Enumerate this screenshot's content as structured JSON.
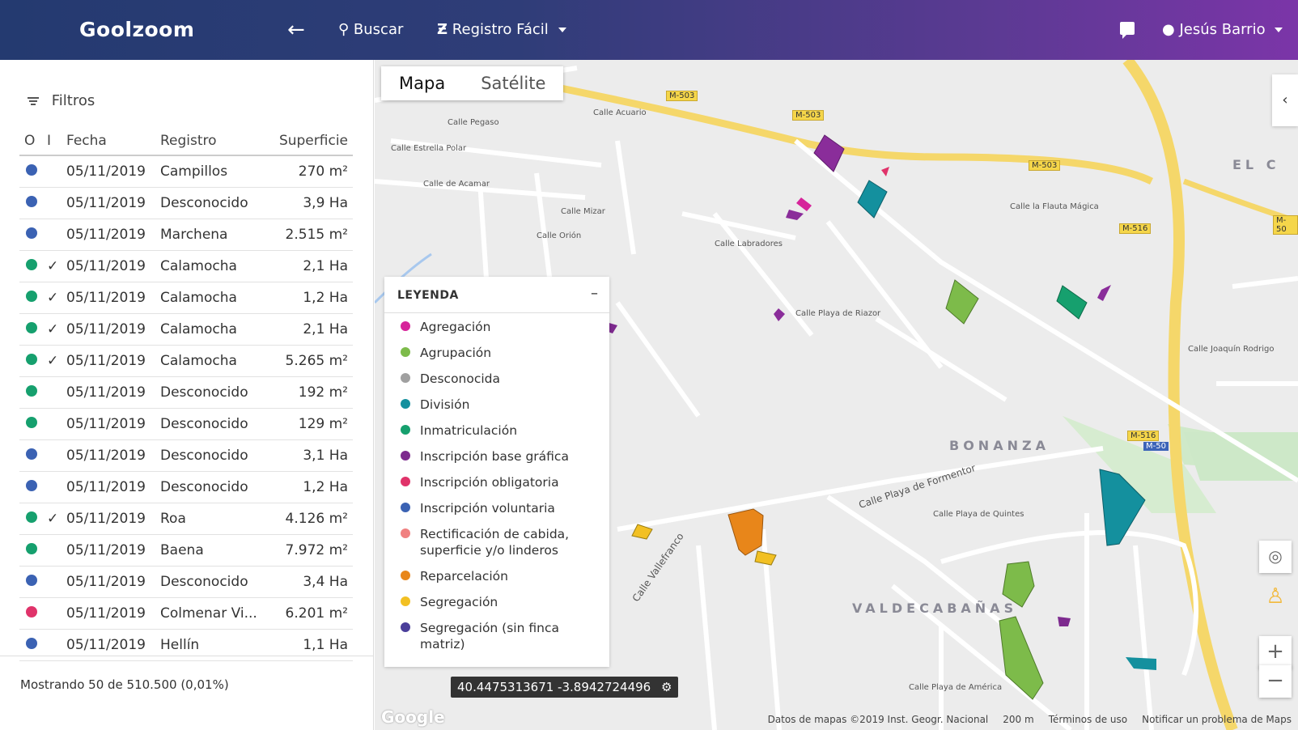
{
  "header": {
    "logo": "Goolzoom",
    "back_glyph": "←",
    "search_label": "Buscar",
    "registro_label": "Registro Fácil",
    "user_label": "Jesús Barrio"
  },
  "sidebar": {
    "filters_label": "Filtros",
    "columns": [
      "O",
      "I",
      "Fecha",
      "Registro",
      "Superficie"
    ],
    "rows": [
      {
        "color": "#3b62b3",
        "check": "",
        "fecha": "05/11/2019",
        "registro": "Campillos",
        "superficie": "270 m²"
      },
      {
        "color": "#3b62b3",
        "check": "",
        "fecha": "05/11/2019",
        "registro": "Desconocido",
        "superficie": "3,9 Ha"
      },
      {
        "color": "#3b62b3",
        "check": "",
        "fecha": "05/11/2019",
        "registro": "Marchena",
        "superficie": "2.515 m²"
      },
      {
        "color": "#16a06e",
        "check": "✓",
        "fecha": "05/11/2019",
        "registro": "Calamocha",
        "superficie": "2,1 Ha"
      },
      {
        "color": "#16a06e",
        "check": "✓",
        "fecha": "05/11/2019",
        "registro": "Calamocha",
        "superficie": "1,2 Ha"
      },
      {
        "color": "#16a06e",
        "check": "✓",
        "fecha": "05/11/2019",
        "registro": "Calamocha",
        "superficie": "2,1 Ha"
      },
      {
        "color": "#16a06e",
        "check": "✓",
        "fecha": "05/11/2019",
        "registro": "Calamocha",
        "superficie": "5.265 m²"
      },
      {
        "color": "#16a06e",
        "check": "",
        "fecha": "05/11/2019",
        "registro": "Desconocido",
        "superficie": "192 m²"
      },
      {
        "color": "#16a06e",
        "check": "",
        "fecha": "05/11/2019",
        "registro": "Desconocido",
        "superficie": "129 m²"
      },
      {
        "color": "#3b62b3",
        "check": "",
        "fecha": "05/11/2019",
        "registro": "Desconocido",
        "superficie": "3,1 Ha"
      },
      {
        "color": "#3b62b3",
        "check": "",
        "fecha": "05/11/2019",
        "registro": "Desconocido",
        "superficie": "1,2 Ha"
      },
      {
        "color": "#16a06e",
        "check": "✓",
        "fecha": "05/11/2019",
        "registro": "Roa",
        "superficie": "4.126 m²"
      },
      {
        "color": "#16a06e",
        "check": "",
        "fecha": "05/11/2019",
        "registro": "Baena",
        "superficie": "7.972 m²"
      },
      {
        "color": "#3b62b3",
        "check": "",
        "fecha": "05/11/2019",
        "registro": "Desconocido",
        "superficie": "3,4 Ha"
      },
      {
        "color": "#e0336a",
        "check": "",
        "fecha": "05/11/2019",
        "registro": "Colmenar Vi...",
        "superficie": "6.201 m²"
      },
      {
        "color": "#3b62b3",
        "check": "",
        "fecha": "05/11/2019",
        "registro": "Hellín",
        "superficie": "1,1 Ha"
      }
    ],
    "footer": "Mostrando 50 de 510.500 (0,01%)"
  },
  "map": {
    "tabs": [
      "Mapa",
      "Satélite"
    ],
    "legend": {
      "title": "LEYENDA",
      "minimize": "–",
      "items": [
        {
          "label": "Agregación",
          "color": "#d6249a"
        },
        {
          "label": "Agrupación",
          "color": "#7dbb4a"
        },
        {
          "label": "Desconocida",
          "color": "#a0a0a0"
        },
        {
          "label": "División",
          "color": "#14909e"
        },
        {
          "label": "Inmatriculación",
          "color": "#16a06e"
        },
        {
          "label": "Inscripción base gráfica",
          "color": "#7d2a8e"
        },
        {
          "label": "Inscripción obligatoria",
          "color": "#e0336a"
        },
        {
          "label": "Inscripción voluntaria",
          "color": "#3b62b3"
        },
        {
          "label": "Rectificación de cabida, superficie y/o linderos",
          "color": "#f08080"
        },
        {
          "label": "Reparcelación",
          "color": "#e8861a"
        },
        {
          "label": "Segregación",
          "color": "#f2c023"
        },
        {
          "label": "Segregación (sin finca matriz)",
          "color": "#4a3e9a"
        }
      ]
    },
    "coordinates": "40.4475313671 -3.8942724496",
    "footer": {
      "data": "Datos de mapas ©2019 Inst. Geogr. Nacional",
      "scale": "200 m",
      "terms": "Términos de uso",
      "report": "Notificar un problema de Maps"
    },
    "google_logo": "Google",
    "places": [
      "BONANZA",
      "VALDECABAÑAS",
      "EL C"
    ],
    "streets": [
      "Calle Acuario",
      "Calle Pegaso",
      "Calle Estrella Polar",
      "Calle de Acamar",
      "Calle Mizar",
      "Calle Orión",
      "Calle Labradores",
      "Calle Playa de Riazor",
      "Calle Playa de Formentor",
      "Calle Playa de Quintes",
      "Calle Vallefranco",
      "Calle la Flauta Mágica",
      "Calle Joaquín Rodrigo",
      "Calle Playa de América"
    ],
    "highways": [
      "M-503",
      "M-503",
      "M-503",
      "M-516",
      "M-516",
      "M-50",
      "M-50"
    ]
  }
}
